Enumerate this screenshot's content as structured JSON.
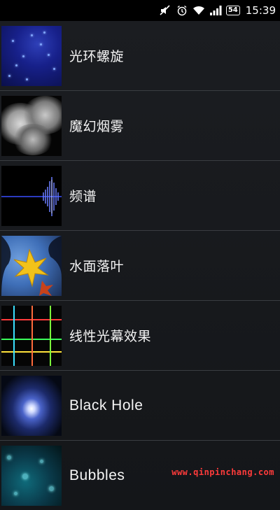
{
  "status_bar": {
    "icons": [
      "mute-icon",
      "alarm-icon",
      "wifi-icon",
      "signal-icon"
    ],
    "battery": "54",
    "time": "15:39"
  },
  "items": [
    {
      "label": "光环螺旋",
      "thumbnail": "blue-particle-spiral"
    },
    {
      "label": "魔幻烟雾",
      "thumbnail": "grey-smoke"
    },
    {
      "label": "频谱",
      "thumbnail": "blue-spectrum-wave"
    },
    {
      "label": "水面落叶",
      "thumbnail": "maple-leaves-on-water"
    },
    {
      "label": "线性光幕效果",
      "thumbnail": "colored-light-lines"
    },
    {
      "label": "Black Hole",
      "thumbnail": "glowing-black-hole"
    },
    {
      "label": "Bubbles",
      "thumbnail": "cyan-bubbles"
    }
  ],
  "watermark": "www.qinpinchang.com",
  "colors": {
    "background": "#1b1d21",
    "divider": "#3a3d42",
    "text": "#f4f4f4",
    "watermark": "#ff3b3b"
  }
}
